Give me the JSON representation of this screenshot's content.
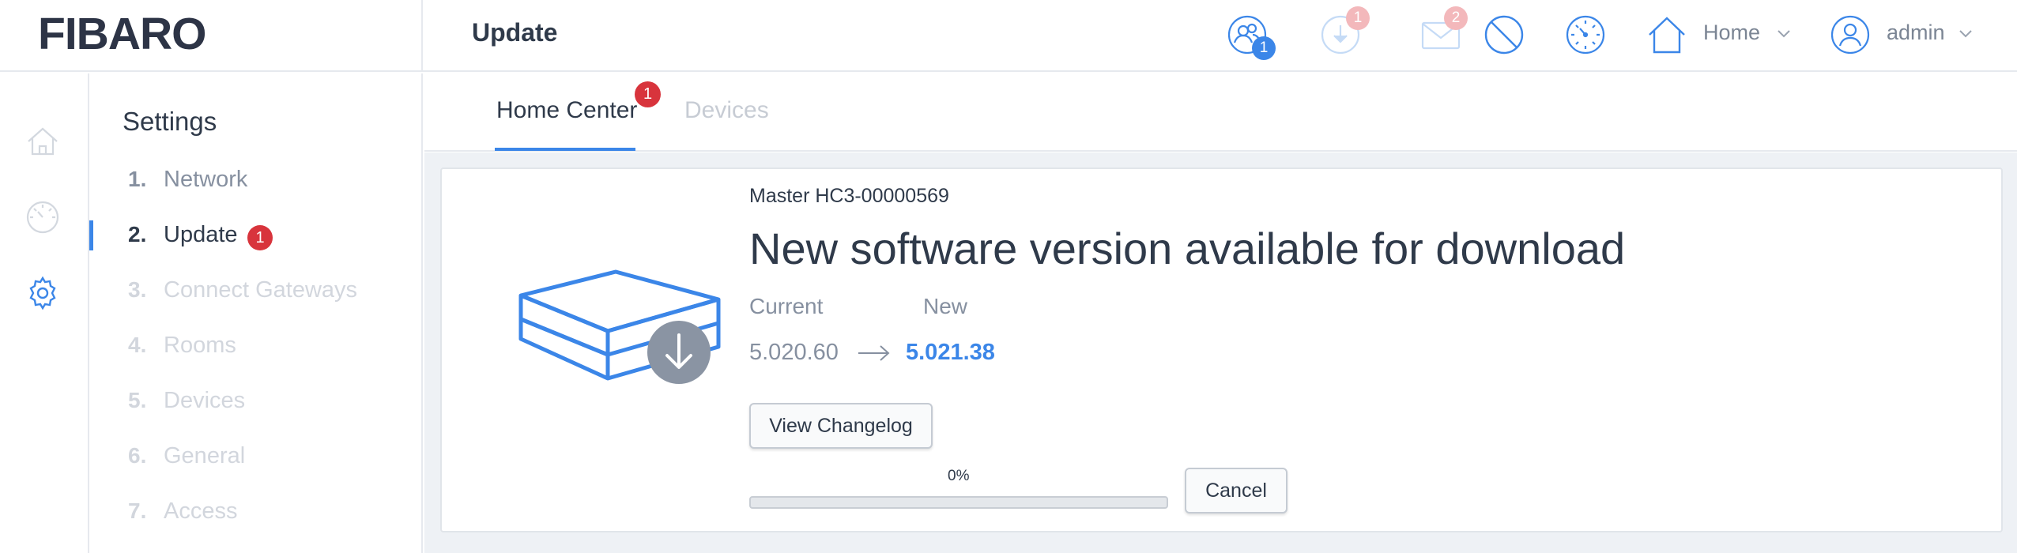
{
  "brand": {
    "logo_text": "FIBARO",
    "accent_color": "#3b86e8",
    "badge_color": "#d8343c"
  },
  "header": {
    "title": "Update",
    "users_badge": "1",
    "download_badge": "1",
    "messages_badge": "2",
    "location_label": "Home",
    "user_label": "admin",
    "icons": [
      "users-icon",
      "download-icon",
      "mail-icon",
      "block-icon",
      "dashboard-icon",
      "home-icon",
      "user-icon"
    ]
  },
  "rail": {
    "icons": [
      "home-icon",
      "dashboard-icon",
      "gear-icon"
    ]
  },
  "settings": {
    "title": "Settings",
    "items": [
      {
        "num": "1.",
        "label": "Network",
        "state": "done"
      },
      {
        "num": "2.",
        "label": "Update",
        "state": "active",
        "badge": "1"
      },
      {
        "num": "3.",
        "label": "Connect Gateways",
        "state": "disabled"
      },
      {
        "num": "4.",
        "label": "Rooms",
        "state": "disabled"
      },
      {
        "num": "5.",
        "label": "Devices",
        "state": "disabled"
      },
      {
        "num": "6.",
        "label": "General",
        "state": "disabled"
      },
      {
        "num": "7.",
        "label": "Access",
        "state": "disabled"
      }
    ]
  },
  "tabs": [
    {
      "label": "Home Center",
      "active": true,
      "badge": "1"
    },
    {
      "label": "Devices",
      "active": false
    }
  ],
  "update": {
    "device_name": "Master HC3-00000569",
    "headline": "New software version available for download",
    "current_label": "Current",
    "new_label": "New",
    "current_version": "5.020.60",
    "new_version": "5.021.38",
    "changelog_button": "View Changelog",
    "progress_percent": "0%",
    "progress_value": 0,
    "cancel_button": "Cancel"
  }
}
